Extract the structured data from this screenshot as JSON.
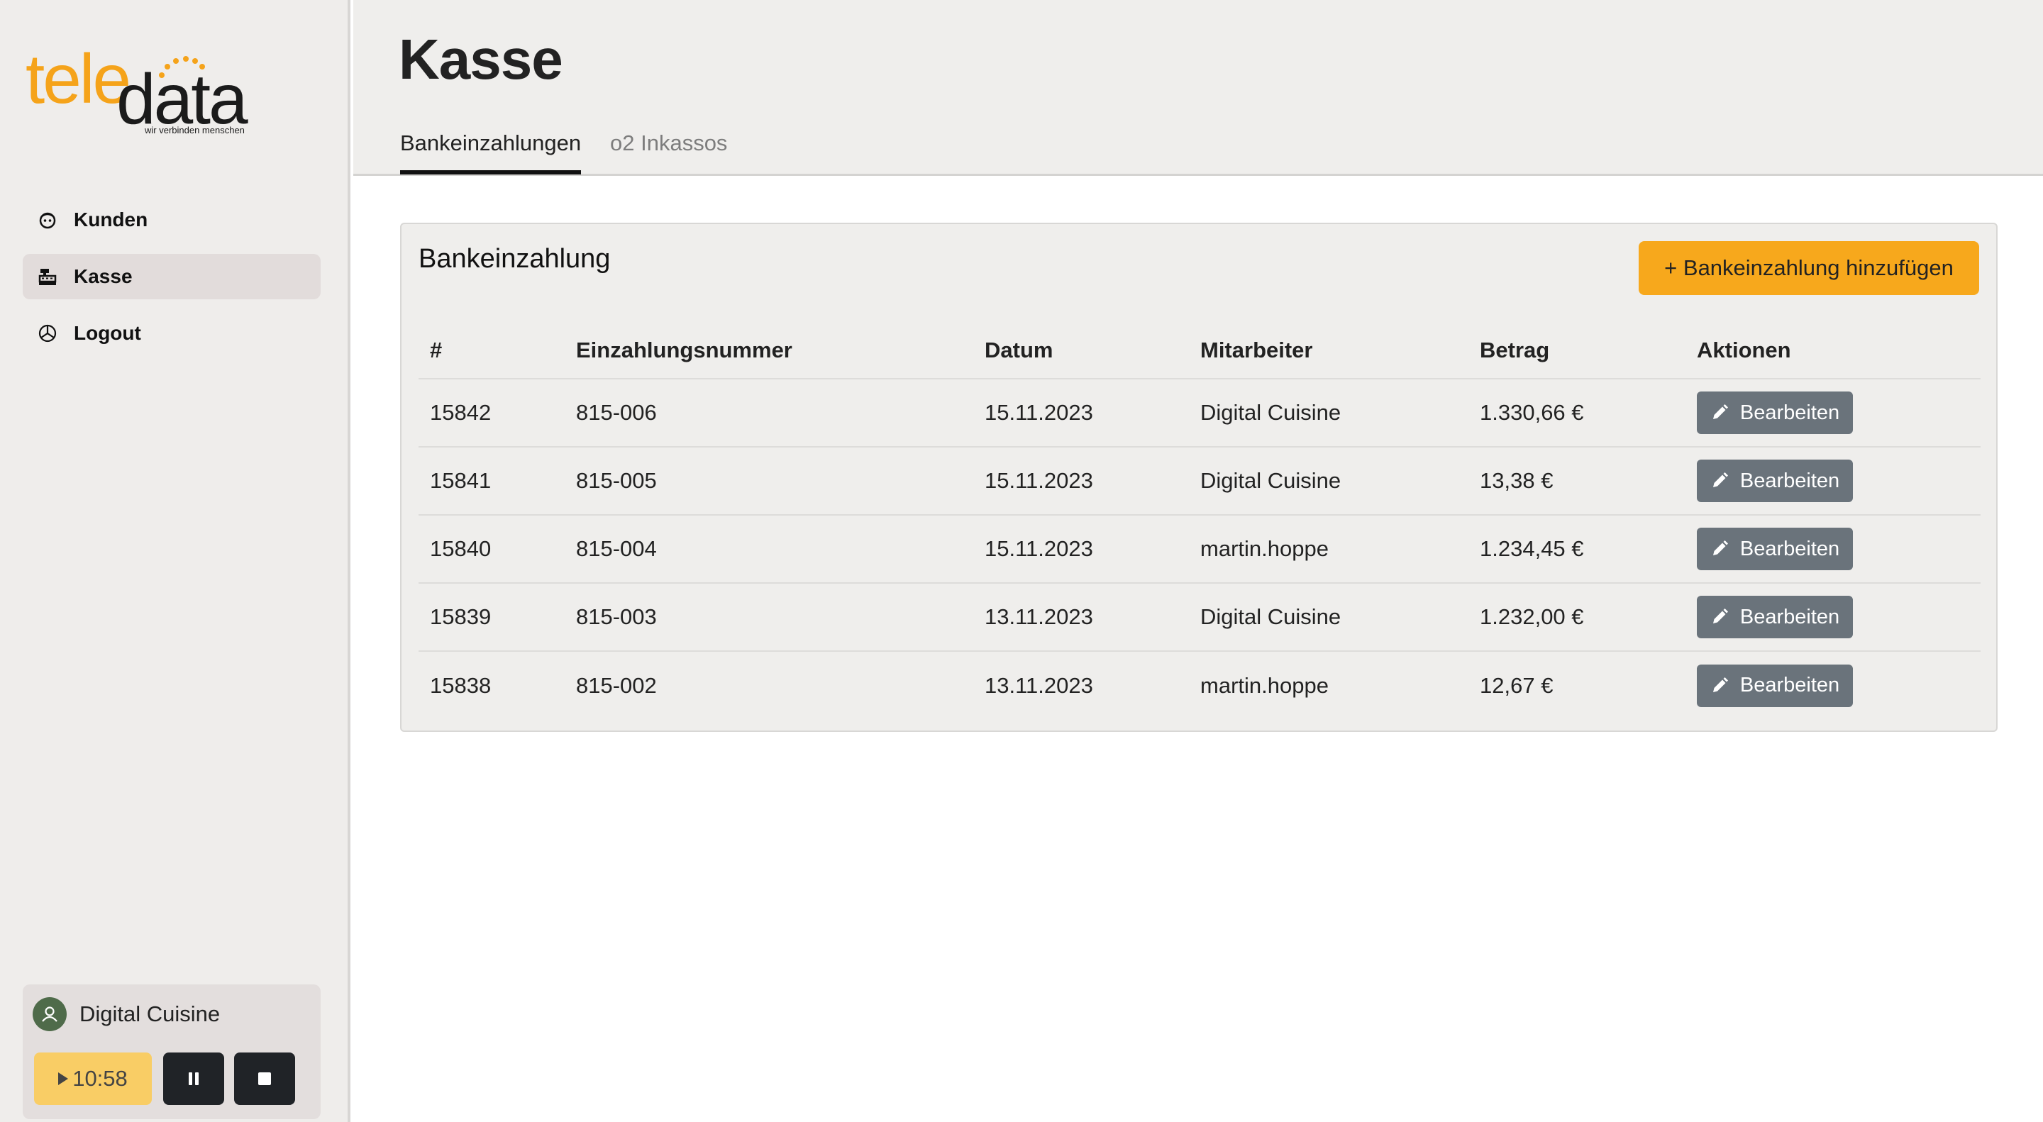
{
  "logo": {
    "part1": "tele",
    "part2": "data",
    "tagline": "wir verbinden menschen"
  },
  "nav": [
    {
      "label": "Kunden",
      "icon": "face-icon"
    },
    {
      "label": "Kasse",
      "icon": "cash-register-icon",
      "active": true
    },
    {
      "label": "Logout",
      "icon": "pie-chart-icon"
    }
  ],
  "user": {
    "name": "Digital Cuisine",
    "timer": "10:58"
  },
  "page": {
    "title": "Kasse"
  },
  "tabs": [
    {
      "label": "Bankeinzahlungen",
      "active": true
    },
    {
      "label": "o2 Inkassos",
      "active": false
    }
  ],
  "card": {
    "title": "Bankeinzahlung",
    "add_button": "+ Bankeinzahlung hinzufügen",
    "columns": [
      "#",
      "Einzahlungsnummer",
      "Datum",
      "Mitarbeiter",
      "Betrag",
      "Aktionen"
    ],
    "rows": [
      {
        "id": "15842",
        "number": "815-006",
        "date": "15.11.2023",
        "employee": "Digital Cuisine",
        "amount": "1.330,66 €",
        "action": "Bearbeiten"
      },
      {
        "id": "15841",
        "number": "815-005",
        "date": "15.11.2023",
        "employee": "Digital Cuisine",
        "amount": "13,38 €",
        "action": "Bearbeiten"
      },
      {
        "id": "15840",
        "number": "815-004",
        "date": "15.11.2023",
        "employee": "martin.hoppe",
        "amount": "1.234,45 €",
        "action": "Bearbeiten"
      },
      {
        "id": "15839",
        "number": "815-003",
        "date": "13.11.2023",
        "employee": "Digital Cuisine",
        "amount": "1.232,00 €",
        "action": "Bearbeiten"
      },
      {
        "id": "15838",
        "number": "815-002",
        "date": "13.11.2023",
        "employee": "martin.hoppe",
        "amount": "12,67 €",
        "action": "Bearbeiten"
      }
    ]
  },
  "colors": {
    "accent": "#f7a81c",
    "logo_orange": "#f5a31a",
    "edit_button": "#6a737b",
    "timer_play": "#f9cd65",
    "timer_controls": "#202327"
  }
}
